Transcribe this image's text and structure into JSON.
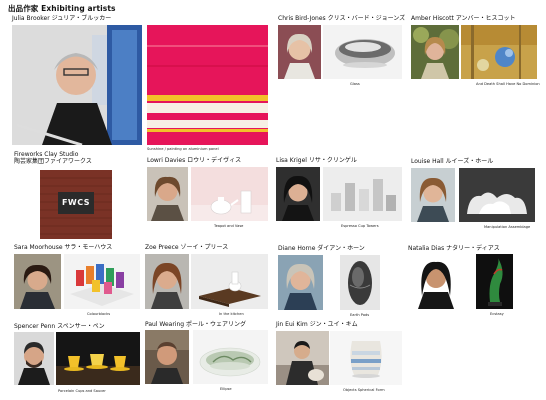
{
  "header": {
    "title": "出品作家  Exhibiting artists"
  },
  "artists": [
    {
      "name": "Julia Brooker ジュリア・ブルッカー",
      "caption": "Sunshine / painting on aluminium panel"
    },
    {
      "name": "Chris Bird-Jones クリス・バード・ジョーンズ",
      "caption": "Glass"
    },
    {
      "name": "Amber Hiscott アンバー・ヒスコット",
      "caption": "And Death Shall Have No Dominion"
    },
    {
      "name": "Fireworks Clay Studio\n陶芸家集団ファイアワークス",
      "caption": "",
      "sign": "FWCS"
    },
    {
      "name": "Lowri Davies ロウリ・デイヴィス",
      "caption": "Teapot and Vase"
    },
    {
      "name": "Lisa Krigel リサ・クリンゲル",
      "caption": "Espresso Cup Towers"
    },
    {
      "name": "Louise Hall ルイーズ・ホール",
      "caption": "Manipulation Assemblage"
    },
    {
      "name": "Sara Moorhouse サラ・モーハウス",
      "caption": "Colourblocks"
    },
    {
      "name": "Zoe Preece ゾーイ・プリース",
      "caption": "In the kitchen"
    },
    {
      "name": "Diane Horne ダイアン・ホーン",
      "caption": "Earth Pods"
    },
    {
      "name": "Natalia Dias ナタリー・ディアス",
      "caption": "Ecstasy"
    },
    {
      "name": "Spencer Penn スペンサー・ペン",
      "caption": "Porcelain Cups and Saucer"
    },
    {
      "name": "Paul Wearing ポール・ウェアリング",
      "caption": "Ellipse"
    },
    {
      "name": "Jin Eui Kim ジン・ユイ・キム",
      "caption": "Objects Spherical Form"
    }
  ],
  "colors": {
    "pink": "#e6155a",
    "yellow": "#f2c12a",
    "brick": "#7a3226",
    "gallery_blue": "#2a62a8"
  }
}
